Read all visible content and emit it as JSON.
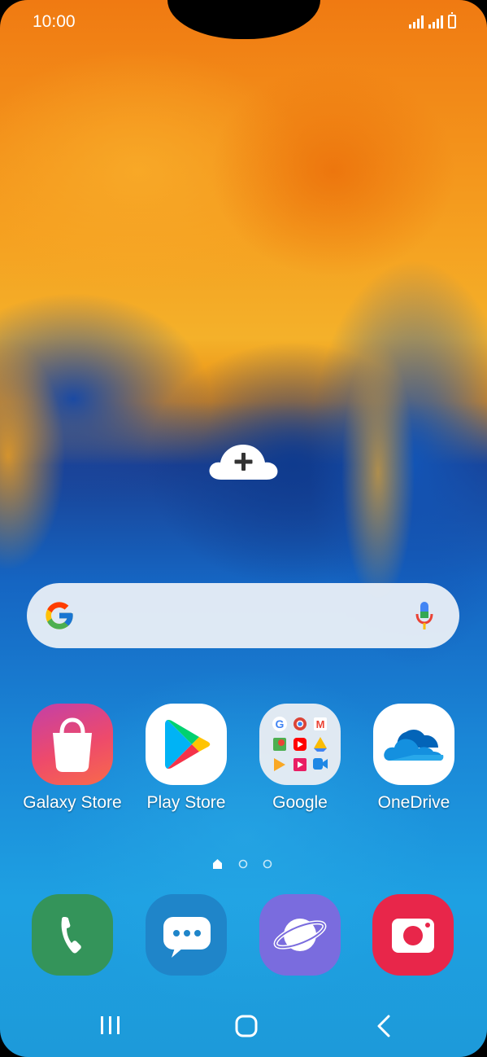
{
  "status_bar": {
    "time": "10:00"
  },
  "search_bar": {
    "placeholder": ""
  },
  "home_apps": [
    {
      "label": "Galaxy Store",
      "icon": "galaxy-store-icon"
    },
    {
      "label": "Play Store",
      "icon": "play-store-icon"
    },
    {
      "label": "Google",
      "icon": "google-folder-icon"
    },
    {
      "label": "OneDrive",
      "icon": "onedrive-icon"
    }
  ],
  "dock_apps": [
    {
      "icon": "phone-icon"
    },
    {
      "icon": "messages-icon"
    },
    {
      "icon": "internet-icon"
    },
    {
      "icon": "camera-icon"
    }
  ],
  "page_indicator": {
    "pages": 3,
    "current": 1
  },
  "colors": {
    "phone": "#34945a",
    "messages": "#1f85c9",
    "internet": "#7a6cde",
    "camera": "#e8264a"
  }
}
